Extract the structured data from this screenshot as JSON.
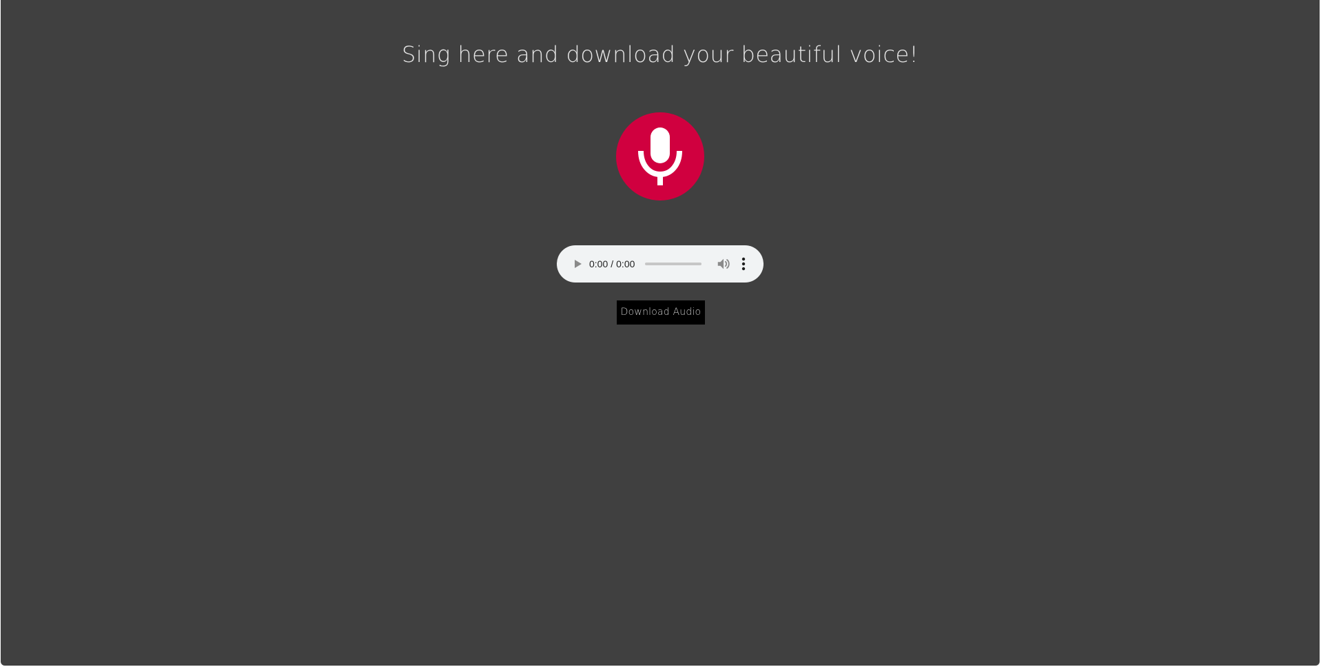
{
  "page": {
    "title": "Sing here and download your beautiful voice!",
    "background_color": "#404040",
    "title_color": "#e6e6e6"
  },
  "record_button": {
    "icon": "microphone-icon",
    "color": "#d0003f"
  },
  "audio_player": {
    "current_time": "0:00",
    "separator": "/",
    "duration": "0:00",
    "progress": 0,
    "play_icon": "play-icon",
    "volume_icon": "volume-icon",
    "menu_icon": "more-vertical-icon",
    "background_color": "#f1f3f4"
  },
  "download": {
    "label": "Download Audio",
    "background_color": "#000000"
  }
}
